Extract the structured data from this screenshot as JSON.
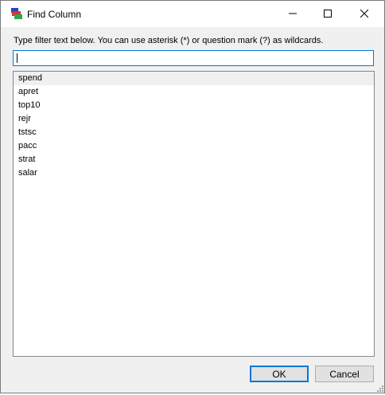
{
  "window": {
    "title": "Find Column"
  },
  "instruction": "Type filter text below. You can use asterisk (*) or question mark (?) as wildcards.",
  "filter": {
    "value": ""
  },
  "columns": [
    {
      "label": "spend",
      "selected": true
    },
    {
      "label": "apret",
      "selected": false
    },
    {
      "label": "top10",
      "selected": false
    },
    {
      "label": "rejr",
      "selected": false
    },
    {
      "label": "tstsc",
      "selected": false
    },
    {
      "label": "pacc",
      "selected": false
    },
    {
      "label": "strat",
      "selected": false
    },
    {
      "label": "salar",
      "selected": false
    }
  ],
  "buttons": {
    "ok": "OK",
    "cancel": "Cancel"
  },
  "icons": {
    "app": "app-logo-icon",
    "minimize": "minimize-icon",
    "maximize": "maximize-icon",
    "close": "close-icon"
  },
  "colors": {
    "accent": "#0078d7",
    "selected_row": "#f0f0f0"
  }
}
